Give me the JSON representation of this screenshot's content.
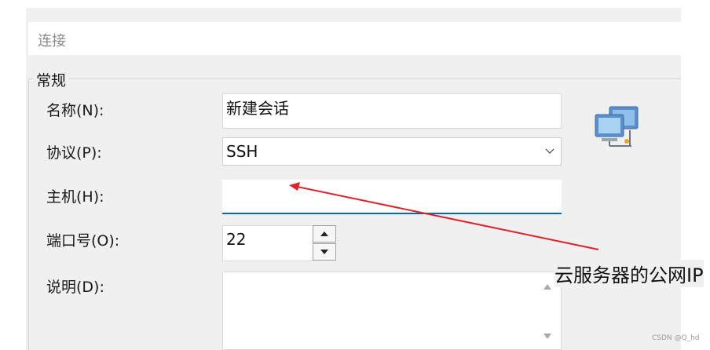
{
  "header": {
    "title": "连接"
  },
  "group": {
    "label": "常规"
  },
  "fields": {
    "name": {
      "label": "名称(N):",
      "value": "新建会话"
    },
    "protocol": {
      "label": "协议(P):",
      "value": "SSH"
    },
    "host": {
      "label": "主机(H):",
      "value": ""
    },
    "port": {
      "label": "端口号(O):",
      "value": "22"
    },
    "description": {
      "label": "说明(D):",
      "value": ""
    }
  },
  "annotation": {
    "text": "云服务器的公网IP"
  },
  "watermark": "CSDN @Q_hd",
  "colors": {
    "arrow": "#e0202a",
    "focus": "#0a64c8",
    "panel": "#f0f0f0"
  },
  "icons": {
    "session": "network-computers-icon"
  }
}
